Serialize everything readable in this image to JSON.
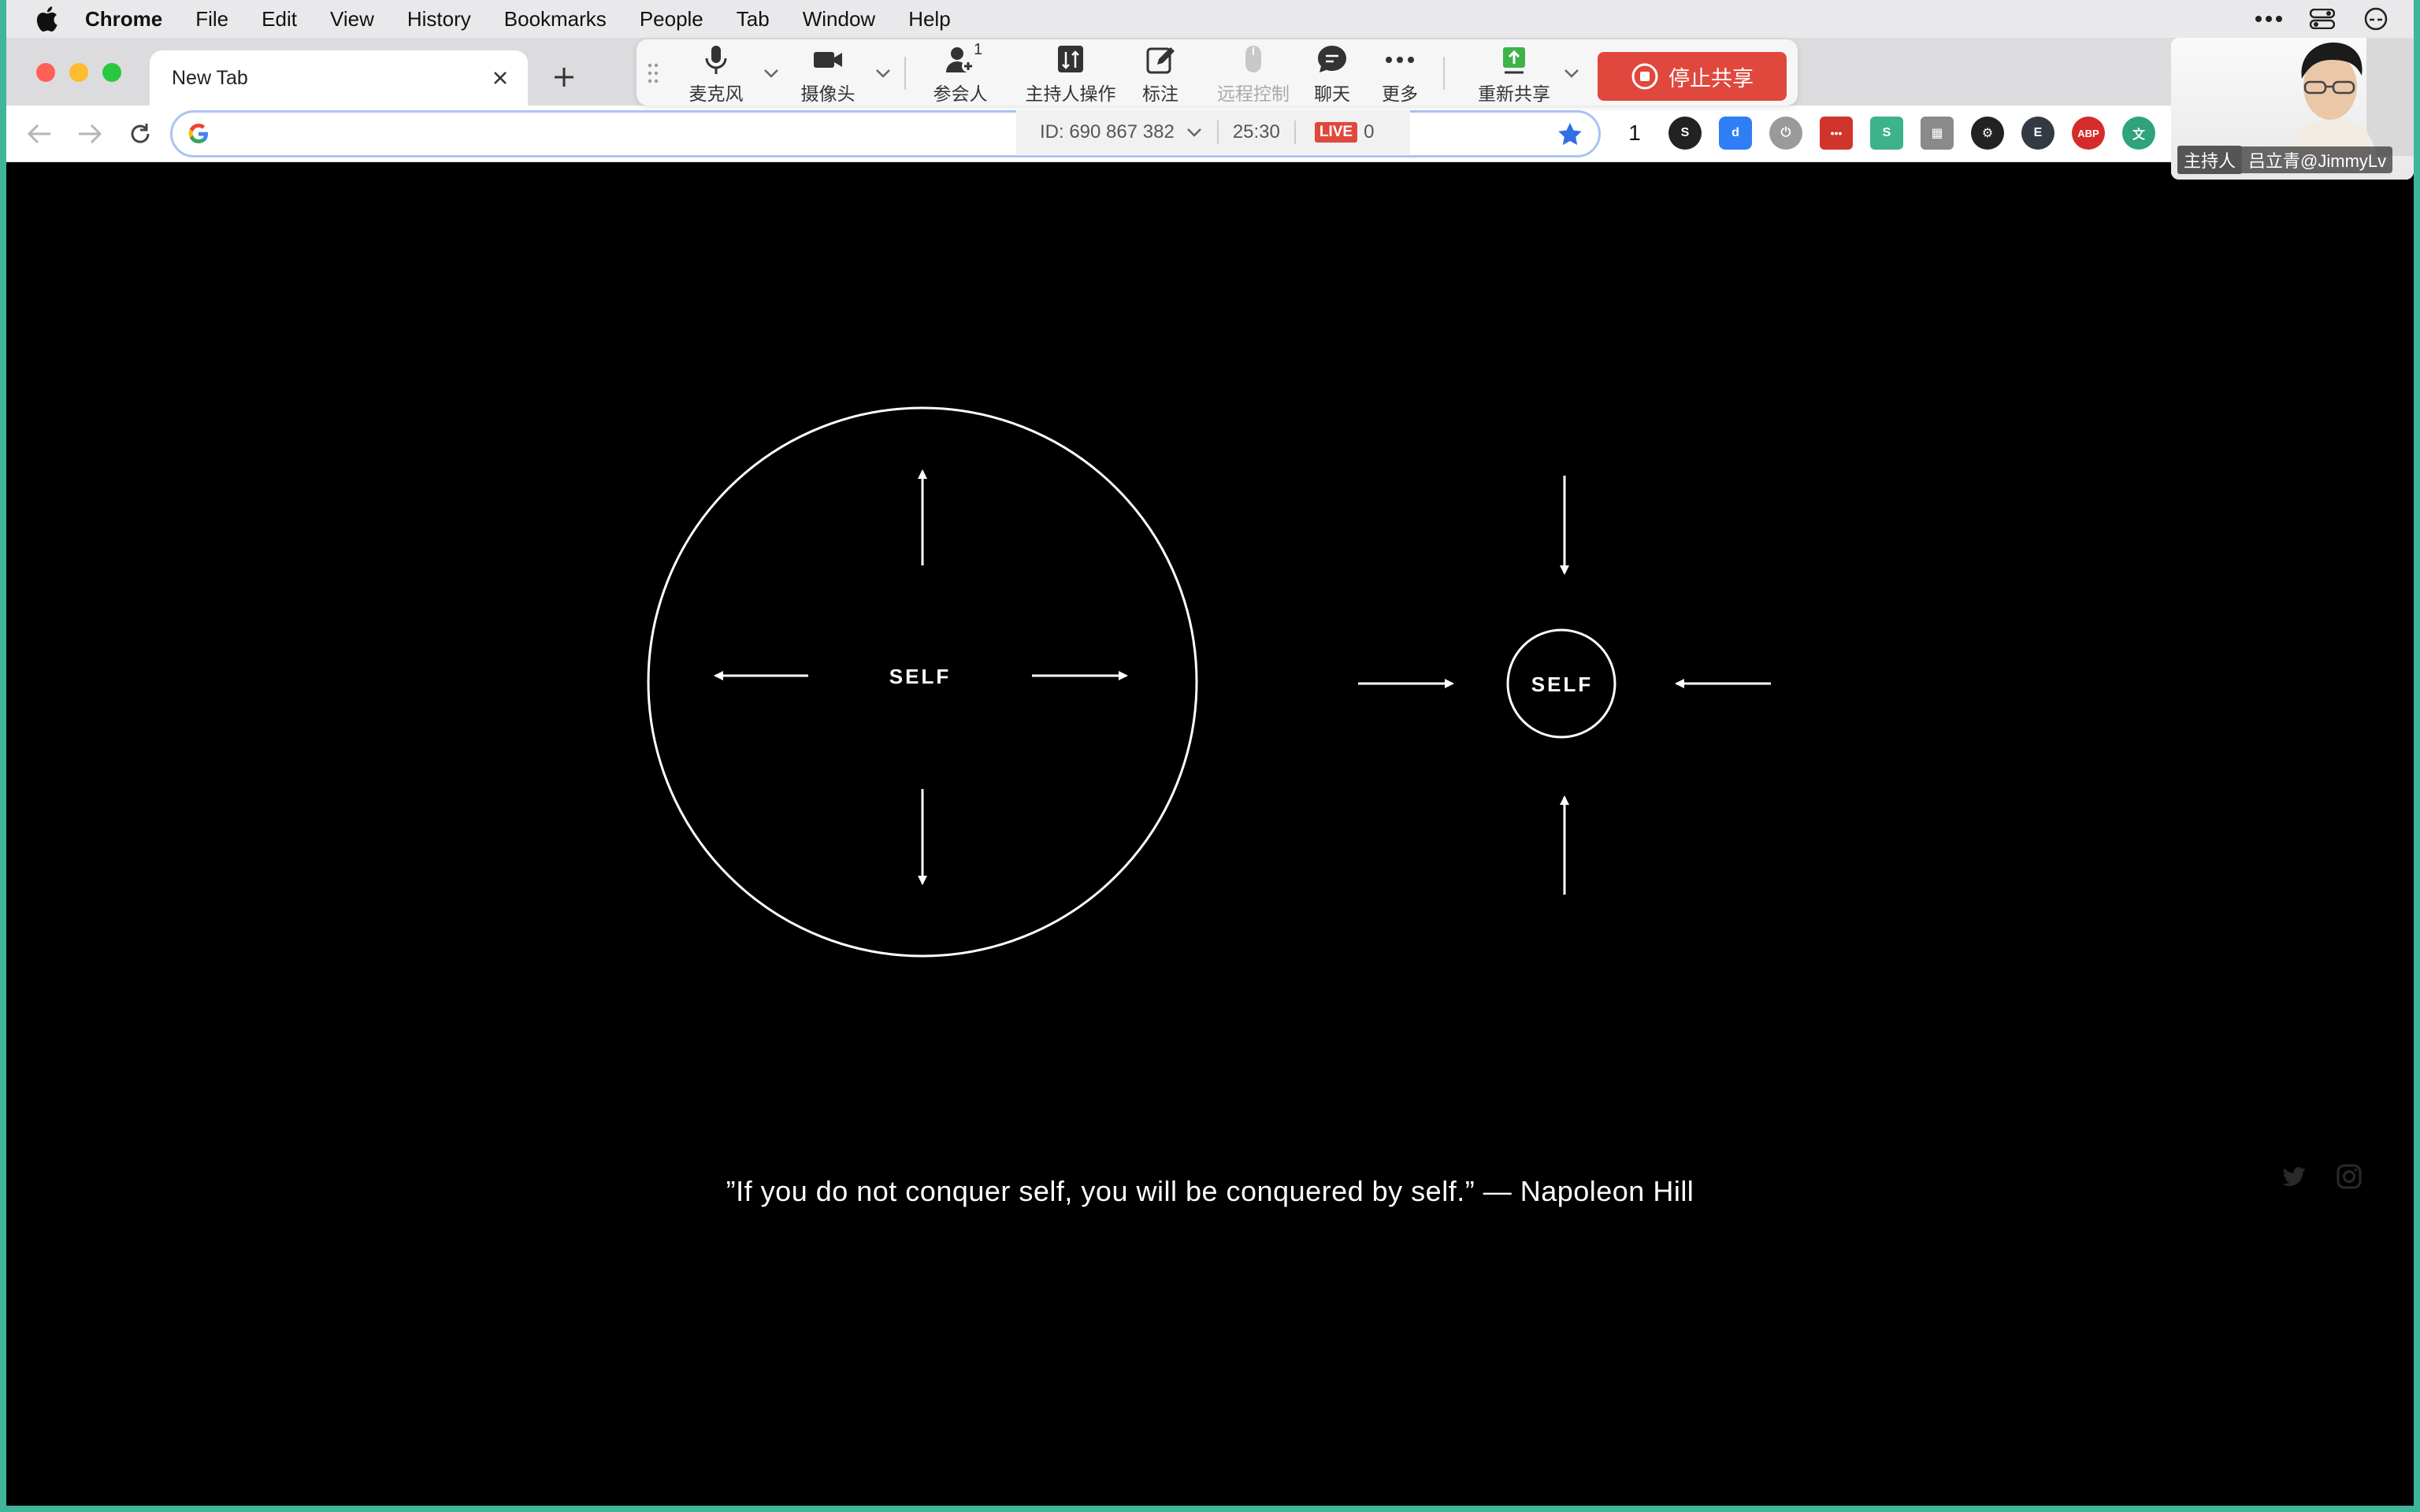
{
  "menubar": {
    "app_name": "Chrome",
    "items": [
      "File",
      "Edit",
      "View",
      "History",
      "Bookmarks",
      "People",
      "Tab",
      "Window",
      "Help"
    ]
  },
  "browser": {
    "tab_title": "New Tab",
    "omnibox_value": "",
    "extensions": [
      {
        "name": "badge-count-extension",
        "text": "1",
        "color": "#ffffff"
      },
      {
        "name": "s-extension",
        "text": "S",
        "color": "#222222"
      },
      {
        "name": "d-extension",
        "text": "d",
        "color": "#2f7ef5"
      },
      {
        "name": "power-extension",
        "text": "⏻",
        "color": "#9a9a9a"
      },
      {
        "name": "dots-extension",
        "text": "•••",
        "color": "#d0342c"
      },
      {
        "name": "s-green-extension",
        "text": "S",
        "color": "#3db389"
      },
      {
        "name": "grid-extension",
        "text": "▦",
        "color": "#8a8a8a"
      },
      {
        "name": "wheel-extension",
        "text": "⚙",
        "color": "#222222"
      },
      {
        "name": "e-extension",
        "text": "E",
        "color": "#333a44"
      },
      {
        "name": "abp-extension",
        "text": "ABP",
        "color": "#d62b2b"
      },
      {
        "name": "translate-extension",
        "text": "文",
        "color": "#2fa37a"
      }
    ]
  },
  "meeting": {
    "mic_label": "麦克风",
    "camera_label": "摄像头",
    "participants_label": "参会人",
    "participants_count": "1",
    "host_actions_label": "主持人操作",
    "annotate_label": "标注",
    "remote_control_label": "远程控制",
    "chat_label": "聊天",
    "more_label": "更多",
    "reshare_label": "重新共享",
    "stop_share_label": "停止共享",
    "meeting_id": "ID: 690 867 382",
    "timer": "25:30",
    "live_label": "LIVE",
    "live_count": "0",
    "host_role": "主持人",
    "host_name": "吕立青@JimmyLv",
    "accent_red": "#e0483e"
  },
  "page": {
    "diagram_left_label": "SELF",
    "diagram_right_label": "SELF",
    "quote": "”If you do not conquer self, you will be conquered by self.” — Napoleon Hill",
    "social_icons": [
      "twitter-icon",
      "instagram-icon"
    ]
  }
}
